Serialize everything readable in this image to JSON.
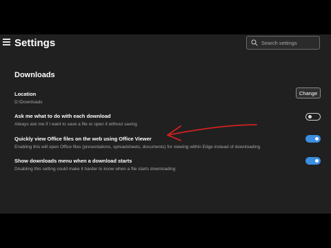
{
  "header": {
    "title": "Settings",
    "menu_icon": "hamburger-menu-icon",
    "search_icon": "search-icon",
    "search_placeholder": "Search settings"
  },
  "downloads": {
    "section_title": "Downloads",
    "location": {
      "title": "Location",
      "value": "D:\\Downloads",
      "change_label": "Change"
    },
    "settings": [
      {
        "title": "Ask me what to do with each download",
        "description": "Always ask me if I want to save a file or open it without saving",
        "enabled": false
      },
      {
        "title": "Quickly view Office files on the web using Office Viewer",
        "description": "Enabling this will open Office files (presentations, spreadsheets, documents) for viewing within Edge instead of downloading",
        "enabled": true
      },
      {
        "title": "Show downloads menu when a download starts",
        "description": "Disabling this setting could make it harder to know when a file starts downloading",
        "enabled": true
      }
    ]
  },
  "colors": {
    "background": "#202020",
    "toggle_on": "#3b8ee0",
    "annotation_arrow": "#d42020"
  }
}
